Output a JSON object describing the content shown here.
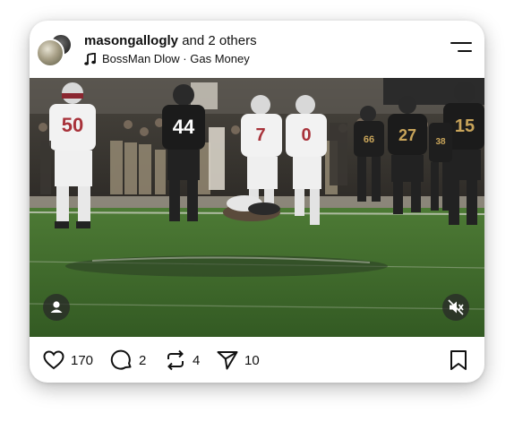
{
  "post": {
    "username": "masongallogly",
    "coauthors_text": " and 2 others",
    "music": "BossMan Dlow · Gas Money"
  },
  "actions": {
    "likes": "170",
    "comments": "2",
    "reposts": "4",
    "shares": "10"
  },
  "photo": {
    "jersey_numbers": [
      "50",
      "44",
      "7",
      "0",
      "27",
      "15",
      "66",
      "38"
    ]
  },
  "colors": {
    "field_green": "#3f6a2c",
    "opponent_jersey": "#f2f2f2",
    "home_jersey": "#1b1b1b",
    "number_red": "#a8323a",
    "number_gold": "#c8a45a"
  },
  "icons": [
    "music-note-icon",
    "menu-icon",
    "user-tag-icon",
    "mute-icon",
    "heart-icon",
    "comment-icon",
    "repost-icon",
    "share-icon",
    "bookmark-icon"
  ]
}
